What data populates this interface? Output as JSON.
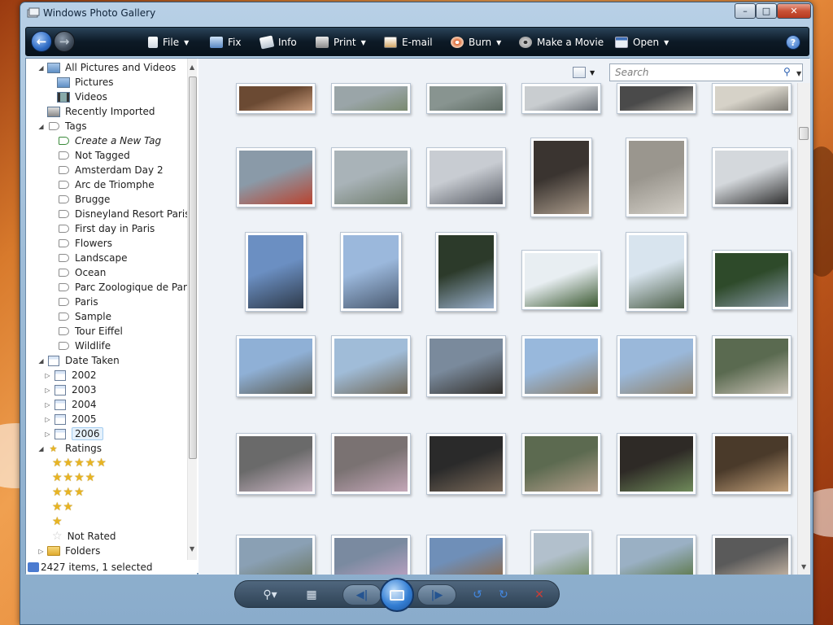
{
  "window": {
    "title": "Windows Photo Gallery",
    "min": "–",
    "max": "□",
    "close": "✕"
  },
  "toolbar": {
    "file": "File",
    "fix": "Fix",
    "info": "Info",
    "print": "Print",
    "email": "E-mail",
    "burn": "Burn",
    "make_movie": "Make a Movie",
    "open": "Open",
    "help": "?"
  },
  "nav": {
    "all": "All Pictures and Videos",
    "pictures": "Pictures",
    "videos": "Videos",
    "recent": "Recently Imported",
    "tags": "Tags",
    "tag_items": [
      "Create a New Tag",
      "Not Tagged",
      "Amsterdam Day 2",
      "Arc de Triomphe",
      "Brugge",
      "Disneyland Resort Paris",
      "First day in Paris",
      "Flowers",
      "Landscape",
      "Ocean",
      "Parc Zoologique de Paris",
      "Paris",
      "Sample",
      "Tour Eiffel",
      "Wildlife"
    ],
    "date_taken": "Date Taken",
    "years": [
      "2002",
      "2003",
      "2004",
      "2005",
      "2006"
    ],
    "selected_year": "2006",
    "ratings": "Ratings",
    "not_rated": "Not Rated",
    "folders": "Folders"
  },
  "search": {
    "placeholder": "Search"
  },
  "status": {
    "text": "2427 items, 1 selected"
  },
  "thumbnails": [
    {
      "name": "eiffel-base",
      "colors": [
        "#6b4a33",
        "#c79a7a"
      ]
    },
    {
      "name": "champs-elysees",
      "colors": [
        "#9aa5a8",
        "#7a8a70"
      ]
    },
    {
      "name": "city-view",
      "colors": [
        "#889490",
        "#5d6a62"
      ]
    },
    {
      "name": "eiffel-far",
      "colors": [
        "#c9cdd0",
        "#6d7278"
      ]
    },
    {
      "name": "people-street",
      "colors": [
        "#4a4a4a",
        "#a9a49a"
      ]
    },
    {
      "name": "arc-detail",
      "colors": [
        "#d6d2c8",
        "#7d7a73"
      ]
    },
    {
      "name": "telescope-family",
      "colors": [
        "#8a9aa8",
        "#b9432f"
      ]
    },
    {
      "name": "paris-aerial",
      "colors": [
        "#a9b3b8",
        "#6f7c6c"
      ]
    },
    {
      "name": "kids-railing",
      "colors": [
        "#c8ccd2",
        "#5a5e66"
      ]
    },
    {
      "name": "spiral-stairs",
      "colors": [
        "#3a3430",
        "#a99a8a"
      ]
    },
    {
      "name": "arc-ceiling",
      "colors": [
        "#9a968e",
        "#d2cec6"
      ]
    },
    {
      "name": "group-arc",
      "colors": [
        "#d4d8dc",
        "#2f2f2f"
      ]
    },
    {
      "name": "eiffel-sky",
      "colors": [
        "#6b8fc2",
        "#2e3a4a"
      ]
    },
    {
      "name": "eiffel-clouds",
      "colors": [
        "#9bb8dc",
        "#4a5a70"
      ]
    },
    {
      "name": "eiffel-trees",
      "colors": [
        "#2c3a2a",
        "#9ab0cc"
      ]
    },
    {
      "name": "eiffel-leg",
      "colors": [
        "#e8eef2",
        "#3c5a32"
      ]
    },
    {
      "name": "eiffel-up",
      "colors": [
        "#d8e4ee",
        "#4c5e48"
      ]
    },
    {
      "name": "park-people",
      "colors": [
        "#2e4a2a",
        "#8a9aa8"
      ]
    },
    {
      "name": "trocadero-1",
      "colors": [
        "#8fb0d6",
        "#5a5a50"
      ]
    },
    {
      "name": "crowd-plaza",
      "colors": [
        "#a0bcd8",
        "#6e6656"
      ]
    },
    {
      "name": "plaza-shadow",
      "colors": [
        "#7a8a9c",
        "#33302c"
      ]
    },
    {
      "name": "trocadero-2",
      "colors": [
        "#98b8dc",
        "#8a7a62"
      ]
    },
    {
      "name": "trocadero-3",
      "colors": [
        "#9ab8da",
        "#8e8068"
      ]
    },
    {
      "name": "group-tourists",
      "colors": [
        "#5a6a50",
        "#c9c2b6"
      ]
    },
    {
      "name": "kids-slide-1",
      "colors": [
        "#6a6a6a",
        "#c9b4c2"
      ]
    },
    {
      "name": "kids-slide-2",
      "colors": [
        "#7a7272",
        "#c4a7b8"
      ]
    },
    {
      "name": "kids-window",
      "colors": [
        "#2a2a2a",
        "#7a6a5a"
      ]
    },
    {
      "name": "kids-tower",
      "colors": [
        "#5c6a50",
        "#b4a08c"
      ]
    },
    {
      "name": "champ-de-mars",
      "colors": [
        "#2e2a26",
        "#6f8a5a"
      ]
    },
    {
      "name": "elevator-kid",
      "colors": [
        "#4a3a2a",
        "#c2a07a"
      ]
    },
    {
      "name": "paris-river",
      "colors": [
        "#8aa0b4",
        "#6e7a6a"
      ]
    },
    {
      "name": "girl-top",
      "colors": [
        "#7a8aa0",
        "#b8a0c0"
      ]
    },
    {
      "name": "tower-beams",
      "colors": [
        "#6f8fb8",
        "#8a6c52"
      ]
    },
    {
      "name": "aerial-park",
      "colors": [
        "#b2c0cc",
        "#6c8858"
      ]
    },
    {
      "name": "aerial-garden",
      "colors": [
        "#9ab0c4",
        "#5f7a4e"
      ]
    },
    {
      "name": "boy-tower",
      "colors": [
        "#5a5a5a",
        "#c2b2a2"
      ]
    }
  ]
}
